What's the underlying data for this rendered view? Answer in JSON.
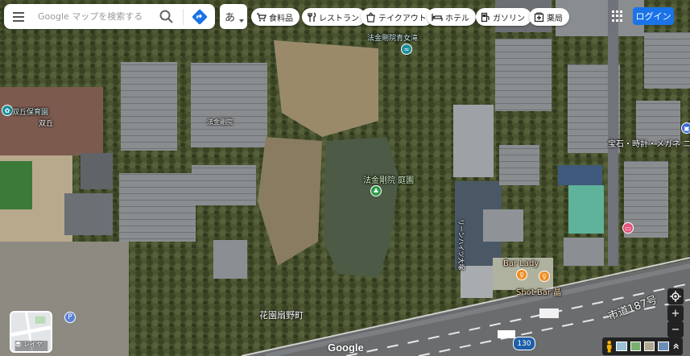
{
  "search": {
    "placeholder": "Google マップを検索する"
  },
  "ime": {
    "label": "あ"
  },
  "categories": [
    {
      "label": "食料品",
      "icon": "cart-icon"
    },
    {
      "label": "レストラン",
      "icon": "fork-knife-icon"
    },
    {
      "label": "テイクアウト",
      "icon": "takeout-icon"
    },
    {
      "label": "ホテル",
      "icon": "bed-icon"
    },
    {
      "label": "ガソリン",
      "icon": "gas-pump-icon"
    },
    {
      "label": "薬局",
      "icon": "pharmacy-icon"
    }
  ],
  "login": {
    "label": "ログイン"
  },
  "places": {
    "nursery": "双丘保育園",
    "nursery_sub": "双丘",
    "youth_home": "法金剛院青女滝",
    "garden": "法金剛院 庭園",
    "hokongoin": "法金剛院",
    "jewelry": "宝石・時計・メガネ ニ",
    "bar_lady": "Bar Lady",
    "shot_bar": "Shot Bar 晶",
    "district": "花園扇野町",
    "building_sign": "リーンハイツ大塚"
  },
  "road": {
    "name": "市道187号",
    "shield": "130"
  },
  "map_controls": {
    "layers_label": "レイヤ",
    "zoom_in": "+",
    "zoom_out": "−"
  },
  "brand": {
    "logo": "Google"
  },
  "colors": {
    "accent": "#1a73e8"
  }
}
